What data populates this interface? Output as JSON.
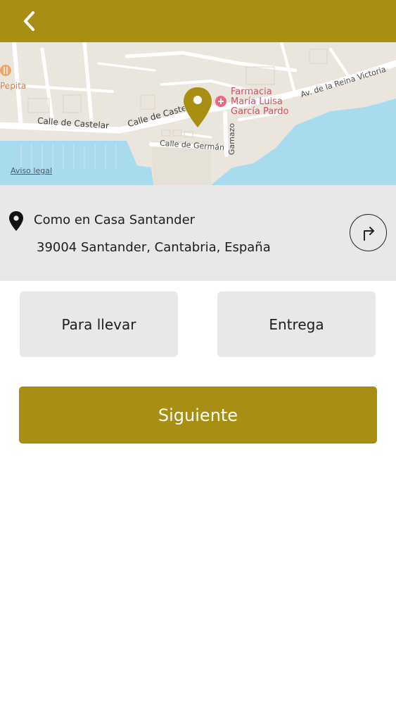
{
  "header": {
    "back_icon": "chevron-left-icon",
    "accent_color": "#a88e12"
  },
  "map": {
    "labels": {
      "poi_pepita": "Pepita",
      "pharmacy_line1": "Farmacia",
      "pharmacy_line2": "María Luisa",
      "pharmacy_line3": "García Pardo",
      "street_castelar": "Calle de Castelar",
      "street_castelar_diag": "Calle de Castelar",
      "street_german": "Calle de Germán",
      "street_gamazo": "Gamazo",
      "street_reina_victoria": "Av. de la Reina Victoria"
    },
    "legal_link": "Aviso legal",
    "pin_icon": "map-pin-icon"
  },
  "location": {
    "name": "Como en Casa Santander",
    "address": "39004 Santander, Cantabria, España",
    "pin_icon": "location-pin-icon",
    "directions_icon": "directions-arrow-icon"
  },
  "order_modes": [
    {
      "label": "Para llevar"
    },
    {
      "label": "Entrega"
    }
  ],
  "actions": {
    "next_label": "Siguiente"
  }
}
